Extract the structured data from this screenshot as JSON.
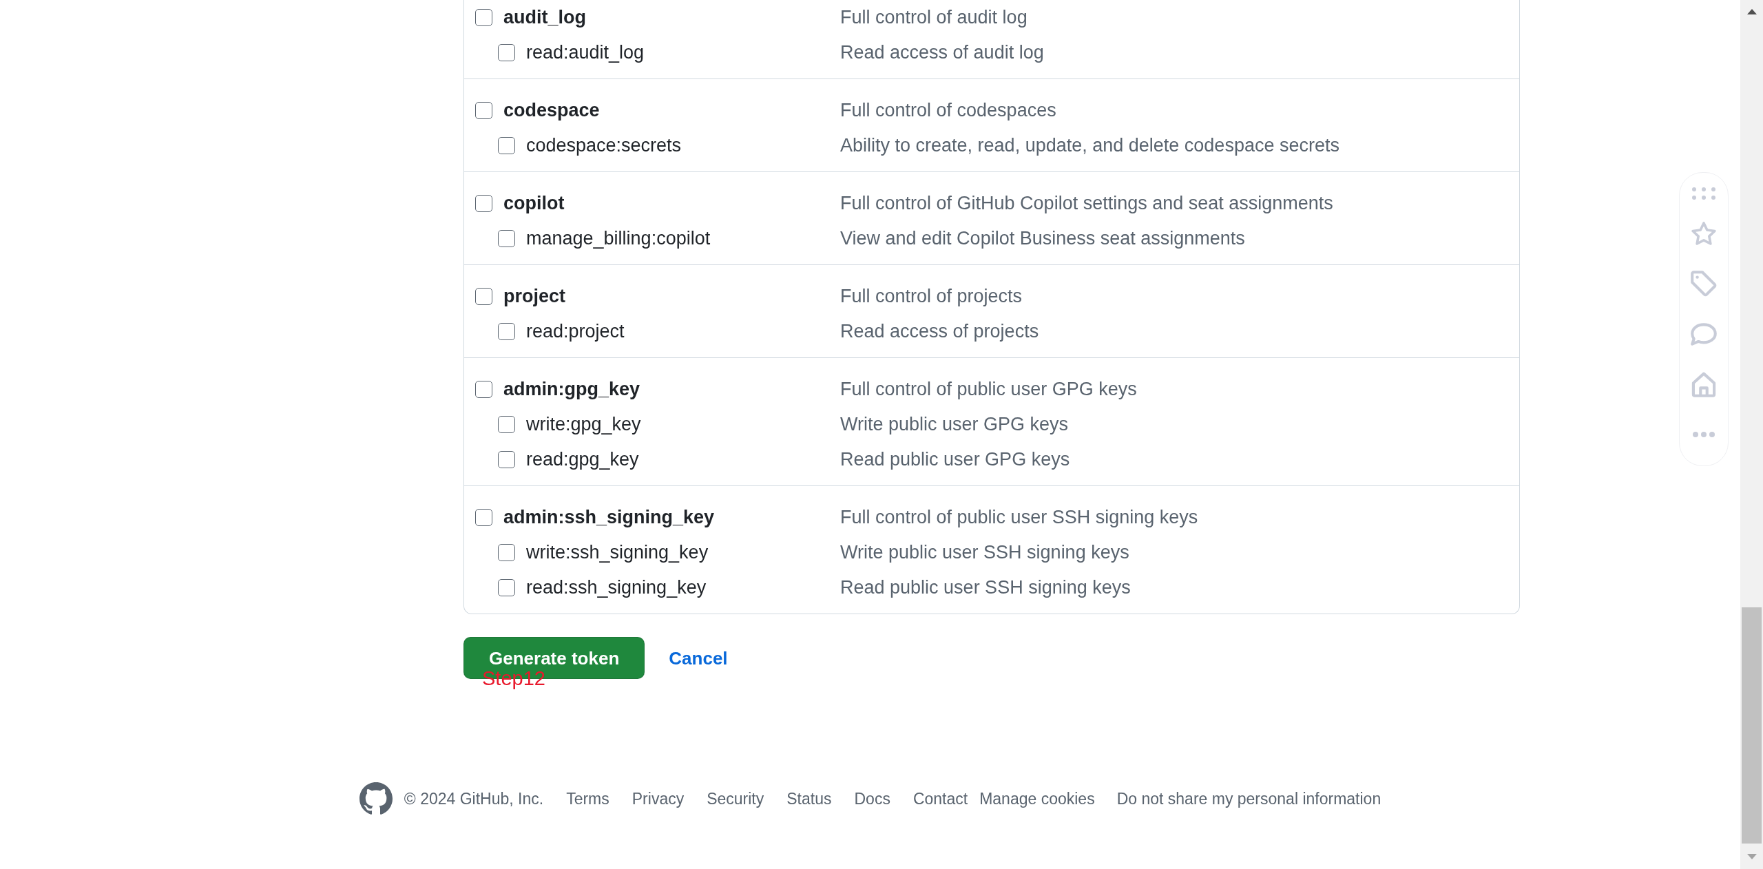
{
  "scopes": [
    {
      "name": "audit_log",
      "description": "Full control of audit log",
      "checked": false,
      "children": [
        {
          "name": "read:audit_log",
          "description": "Read access of audit log",
          "checked": false
        }
      ]
    },
    {
      "name": "codespace",
      "description": "Full control of codespaces",
      "checked": false,
      "children": [
        {
          "name": "codespace:secrets",
          "description": "Ability to create, read, update, and delete codespace secrets",
          "checked": false
        }
      ]
    },
    {
      "name": "copilot",
      "description": "Full control of GitHub Copilot settings and seat assignments",
      "checked": false,
      "children": [
        {
          "name": "manage_billing:copilot",
          "description": "View and edit Copilot Business seat assignments",
          "checked": false
        }
      ]
    },
    {
      "name": "project",
      "description": "Full control of projects",
      "checked": false,
      "children": [
        {
          "name": "read:project",
          "description": "Read access of projects",
          "checked": false
        }
      ]
    },
    {
      "name": "admin:gpg_key",
      "description": "Full control of public user GPG keys",
      "checked": false,
      "children": [
        {
          "name": "write:gpg_key",
          "description": "Write public user GPG keys",
          "checked": false
        },
        {
          "name": "read:gpg_key",
          "description": "Read public user GPG keys",
          "checked": false
        }
      ]
    },
    {
      "name": "admin:ssh_signing_key",
      "description": "Full control of public user SSH signing keys",
      "checked": false,
      "children": [
        {
          "name": "write:ssh_signing_key",
          "description": "Write public user SSH signing keys",
          "checked": false
        },
        {
          "name": "read:ssh_signing_key",
          "description": "Read public user SSH signing keys",
          "checked": false
        }
      ]
    }
  ],
  "actions": {
    "primary": "Generate token",
    "cancel": "Cancel"
  },
  "annotation": {
    "text": "Step12"
  },
  "footer": {
    "copyright": "© 2024 GitHub, Inc.",
    "links": [
      {
        "label": "Terms",
        "kind": "link"
      },
      {
        "label": "Privacy",
        "kind": "link"
      },
      {
        "label": "Security",
        "kind": "link"
      },
      {
        "label": "Status",
        "kind": "link"
      },
      {
        "label": "Docs",
        "kind": "link"
      },
      {
        "label": "Contact",
        "kind": "link"
      },
      {
        "label": "Manage cookies",
        "kind": "button"
      },
      {
        "label": "Do not share my personal information",
        "kind": "button"
      }
    ]
  }
}
